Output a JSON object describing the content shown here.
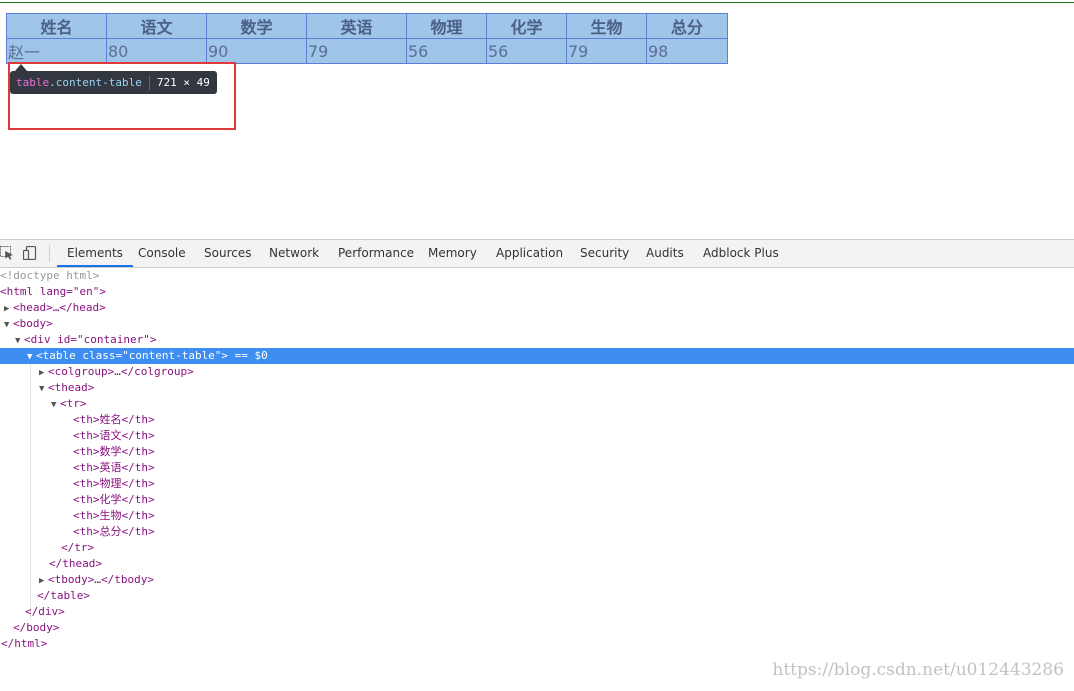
{
  "table": {
    "headers": [
      "姓名",
      "语文",
      "数学",
      "英语",
      "物理",
      "化学",
      "生物",
      "总分"
    ],
    "row": [
      "赵一",
      "80",
      "90",
      "79",
      "56",
      "56",
      "79",
      "98"
    ]
  },
  "tooltip": {
    "tag": "table",
    "class": ".content-table",
    "size": "721 × 49"
  },
  "devtools": {
    "tabs": [
      "Elements",
      "Console",
      "Sources",
      "Network",
      "Performance",
      "Memory",
      "Application",
      "Security",
      "Audits",
      "Adblock Plus"
    ],
    "active_tab": "Elements",
    "lines": [
      "<!doctype html>",
      "<html lang=\"en\">",
      "<head>…</head>",
      "<body>",
      "<div id=\"container\">",
      "<table class=\"content-table\"> == $0",
      "<colgroup>…</colgroup>",
      "<thead>",
      "<tr>",
      "<th>姓名</th>",
      "<th>语文</th>",
      "<th>数学</th>",
      "<th>英语</th>",
      "<th>物理</th>",
      "<th>化学</th>",
      "<th>生物</th>",
      "<th>总分</th>",
      "</tr>",
      "</thead>",
      "<tbody>…</tbody>",
      "</table>",
      "</div>",
      "</body>",
      "</html>"
    ]
  },
  "watermark": "https://blog.csdn.net/u012443286"
}
